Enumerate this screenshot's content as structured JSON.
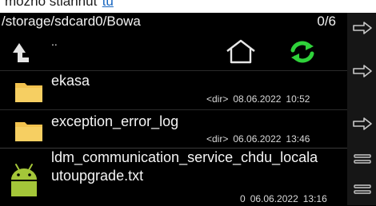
{
  "context_line": {
    "prefix": "možno stiahnuť",
    "link": "tu"
  },
  "path": "/storage/sdcard0/Bowa",
  "selection_count": "0/6",
  "toolbar": {
    "parent_label": ".."
  },
  "files": [
    {
      "name": "ekasa",
      "kind": "<dir>",
      "date": "08.06.2022",
      "time": "10:52",
      "icon": "folder-icon"
    },
    {
      "name": "exception_error_log",
      "kind": "<dir>",
      "date": "06.06.2022",
      "time": "13:46",
      "icon": "folder-icon"
    },
    {
      "name_line1": "ldm_communication_service_chdu_locala",
      "name_line2": "utoupgrade.txt",
      "size": "0",
      "date": "06.06.2022",
      "time": "13:16",
      "icon": "android-file-icon"
    }
  ],
  "colors": {
    "accent_green": "#2fd23a",
    "folder": "#f2c24e",
    "android": "#a4c639"
  }
}
